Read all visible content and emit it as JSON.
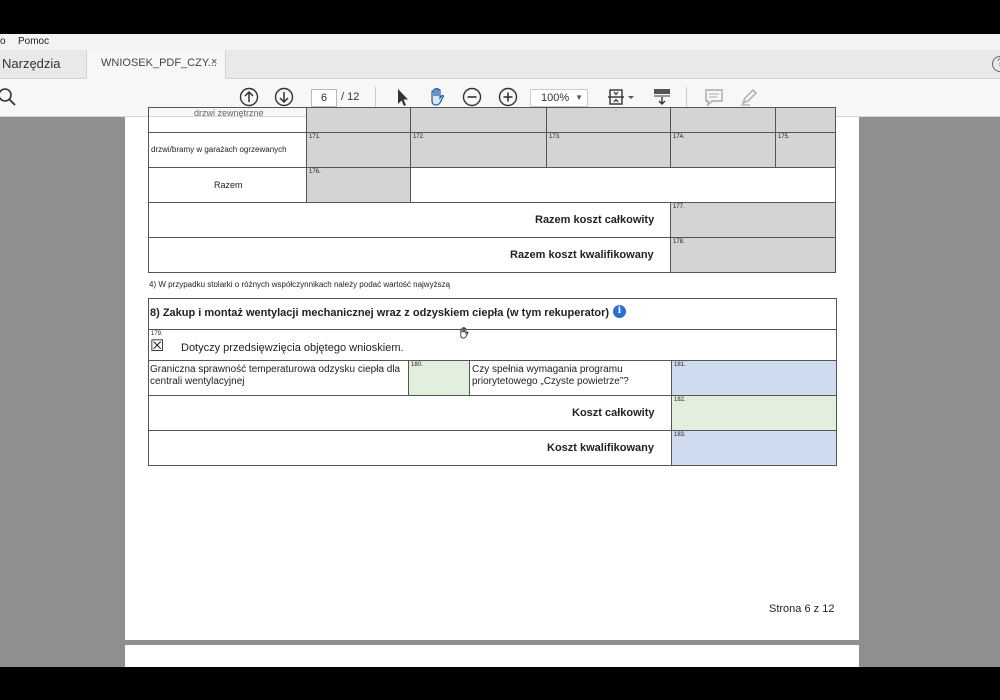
{
  "menu": {
    "left_partial": "o",
    "help": "Pomoc"
  },
  "tabs": {
    "tools": "Narzędzia",
    "document": "WNIOSEK_PDF_CZY...",
    "close": "×"
  },
  "toolbar": {
    "page_current": "6",
    "page_total": "/ 12",
    "zoom": "100%",
    "zoom_arrow": "▼",
    "help_glyph": "?"
  },
  "icons": [
    "search-icon",
    "page-up-icon",
    "page-down-icon",
    "select-cursor-icon",
    "hand-tool-icon",
    "zoom-out-icon",
    "zoom-in-icon",
    "fit-page-icon",
    "scroll-mode-icon",
    "comment-icon",
    "highlight-pen-icon",
    "info-icon",
    "hand-cursor-icon"
  ],
  "form": {
    "row_partial_label": "drzwi zewnętrzne",
    "row_doors_label": "drzwi/bramy w garażach ogrzewanych",
    "cells_171_175": [
      "171.",
      "172.",
      "173.",
      "174.",
      "175."
    ],
    "row_sum_label": "Razem",
    "cell_176": "176.",
    "total_cost_label": "Razem koszt całkowity",
    "cell_177": "177.",
    "qualified_cost_label": "Razem koszt kwalifikowany",
    "cell_178": "178.",
    "footnote": "4) W przypadku stolarki o różnych współczynnikach należy podać wartość najwyższą",
    "section_title": "8) Zakup i montaż wentylacji mechanicznej wraz z odzyskiem ciepła (w tym rekuperator)",
    "cell_179": "179.",
    "checkbox_mark": "☒",
    "checkbox_label": "Dotyczy przedsięwzięcia objętego wnioskiem.",
    "efficiency_label": "Graniczna sprawność temperaturowa odzysku ciepła dla centrali wentylacyjnej",
    "cell_180": "180.",
    "requirement_label": "Czy spełnia wymagania programu priorytetowego „Czyste powietrze”?",
    "cell_181": "181.",
    "cost_total_label": "Koszt całkowity",
    "cell_182": "182.",
    "cost_qualified_label": "Koszt kwalifikowany",
    "cell_183": "183.",
    "page_footer": "Strona 6 z 12"
  },
  "colors": {
    "gray_cell": "#d4d4d4",
    "blue_cell": "#cfdcf0",
    "green_cell": "#e2efdc",
    "workspace": "#8f8f8f"
  }
}
